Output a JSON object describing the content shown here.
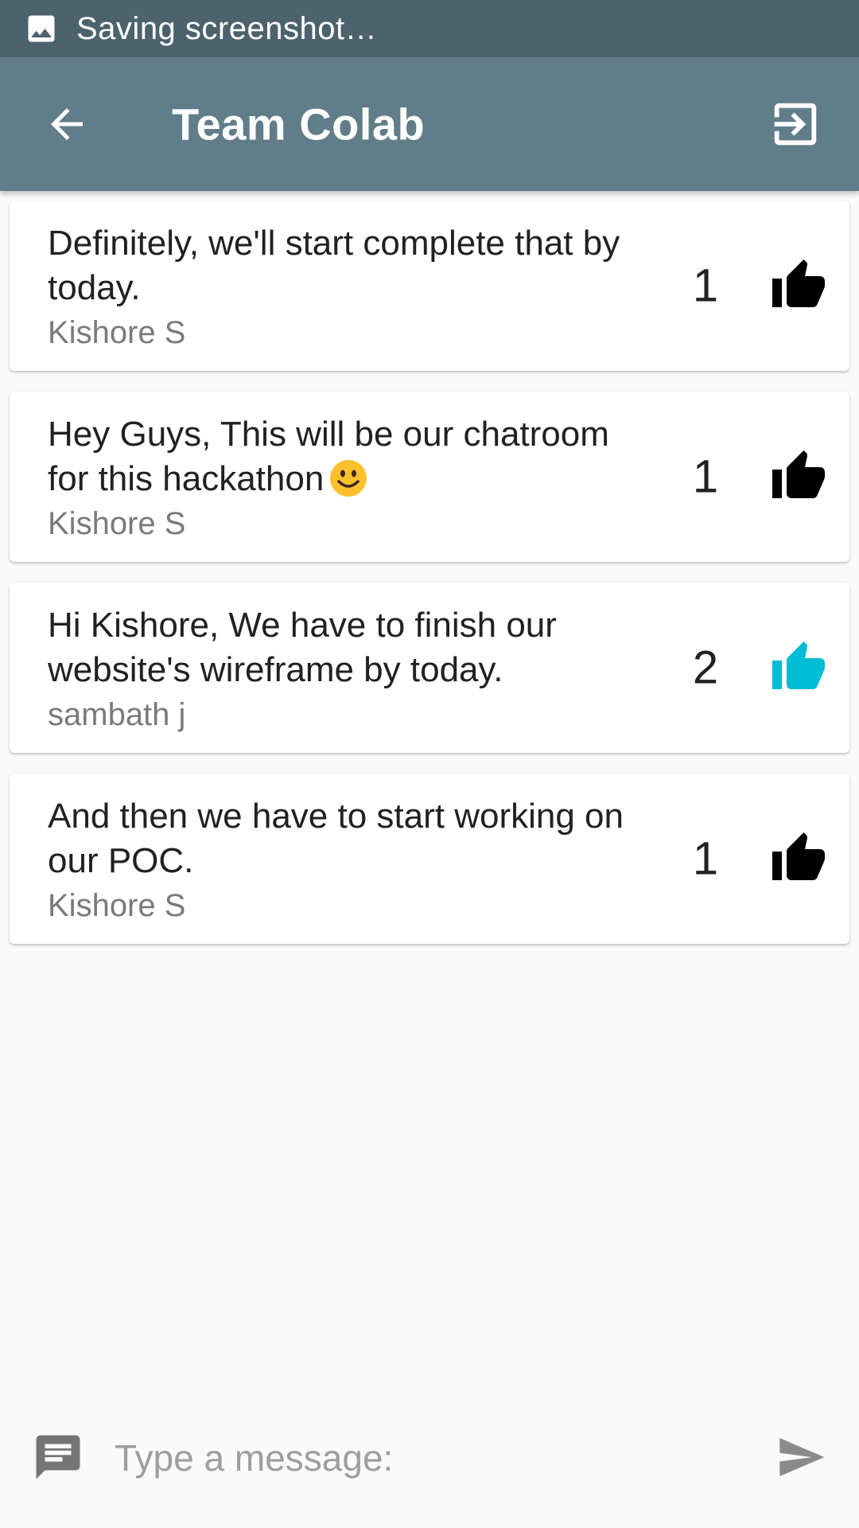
{
  "status_bar": {
    "text": "Saving screenshot…",
    "icon": "image-icon"
  },
  "app_bar": {
    "title": "Team Colab",
    "back_icon": "arrow-back-icon",
    "exit_icon": "exit-to-app-icon",
    "background": "#607d89"
  },
  "messages": [
    {
      "text": "Definitely, we'll start complete that by today.",
      "author": "Kishore S",
      "likes": "1",
      "liked": false
    },
    {
      "text": "Hey Guys, This will be our chatroom for this hackathon",
      "emoji": "smiley-emoji",
      "author": "Kishore S",
      "likes": "1",
      "liked": false
    },
    {
      "text": "Hi Kishore, We have to finish our website's wireframe by today.",
      "author": "sambath j",
      "likes": "2",
      "liked": true
    },
    {
      "text": "And then we have to start working on our POC.",
      "author": "Kishore S",
      "likes": "1",
      "liked": false
    }
  ],
  "colors": {
    "like_default": "#000000",
    "like_active": "#00bcd4"
  },
  "composer": {
    "placeholder": "Type a message:",
    "value": "",
    "chat_icon": "chat-icon",
    "send_icon": "send-icon"
  }
}
